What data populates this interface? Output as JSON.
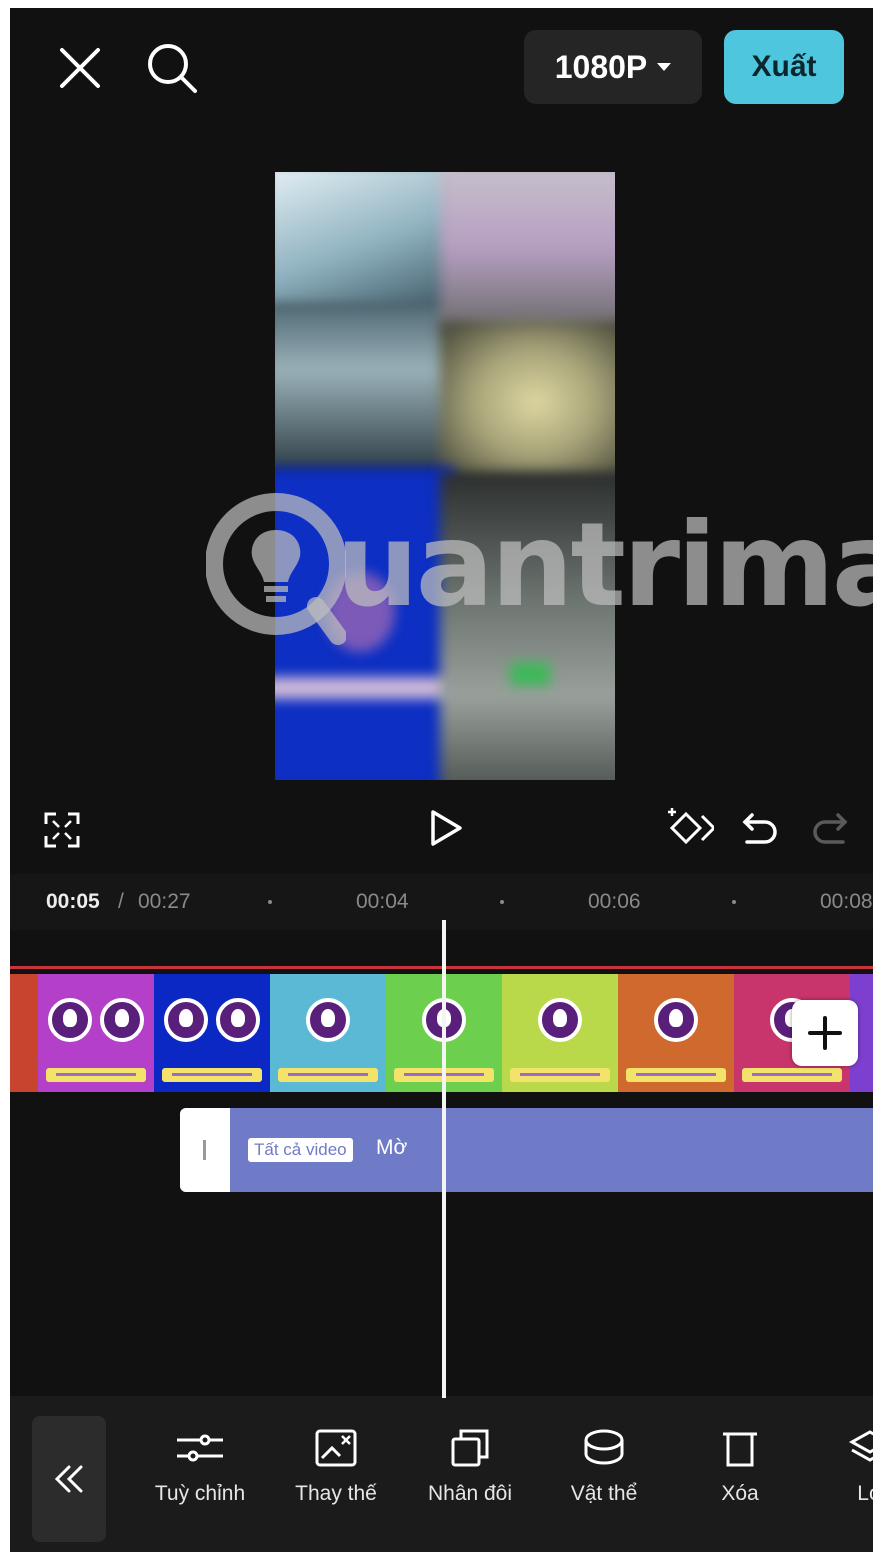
{
  "header": {
    "close_icon": "close-icon",
    "search_icon": "search-icon",
    "resolution": "1080P",
    "export_label": "Xuất"
  },
  "watermark": {
    "text": "uantrimang"
  },
  "controls": {
    "fullscreen_icon": "fullscreen-icon",
    "play_icon": "play-icon",
    "keyframe_icon": "keyframe-icon",
    "undo_icon": "undo-icon",
    "redo_icon": "redo-icon"
  },
  "timeline": {
    "current_time": "00:05",
    "separator": "/",
    "total_time": "00:27",
    "ruler_marks": [
      "00:04",
      "00:06",
      "00:08"
    ]
  },
  "frames": [
    {
      "color": "#c8442e",
      "logos": 0
    },
    {
      "color": "#b43fc8",
      "logos": 2
    },
    {
      "color": "#0b28c4",
      "logos": 2
    },
    {
      "color": "#5ab9d4",
      "logos": 1
    },
    {
      "color": "#6ccf4e",
      "logos": 1
    },
    {
      "color": "#b9d94a",
      "logos": 1
    },
    {
      "color": "#d0692d",
      "logos": 1
    },
    {
      "color": "#c8346c",
      "logos": 1
    },
    {
      "color": "#7d3fd0",
      "logos": 0
    }
  ],
  "effect_track": {
    "tag": "Tất cả video",
    "name": "Mờ"
  },
  "toolbar": {
    "back_icon": "double-chevron-left-icon",
    "items": [
      {
        "label": "Tuỳ chỉnh",
        "icon": "adjust-sliders-icon"
      },
      {
        "label": "Thay thế",
        "icon": "replace-icon"
      },
      {
        "label": "Nhân đôi",
        "icon": "duplicate-icon"
      },
      {
        "label": "Vật thể",
        "icon": "object-icon"
      },
      {
        "label": "Xóa",
        "icon": "trash-icon"
      },
      {
        "label": "Lớ",
        "icon": "layers-icon"
      }
    ]
  }
}
